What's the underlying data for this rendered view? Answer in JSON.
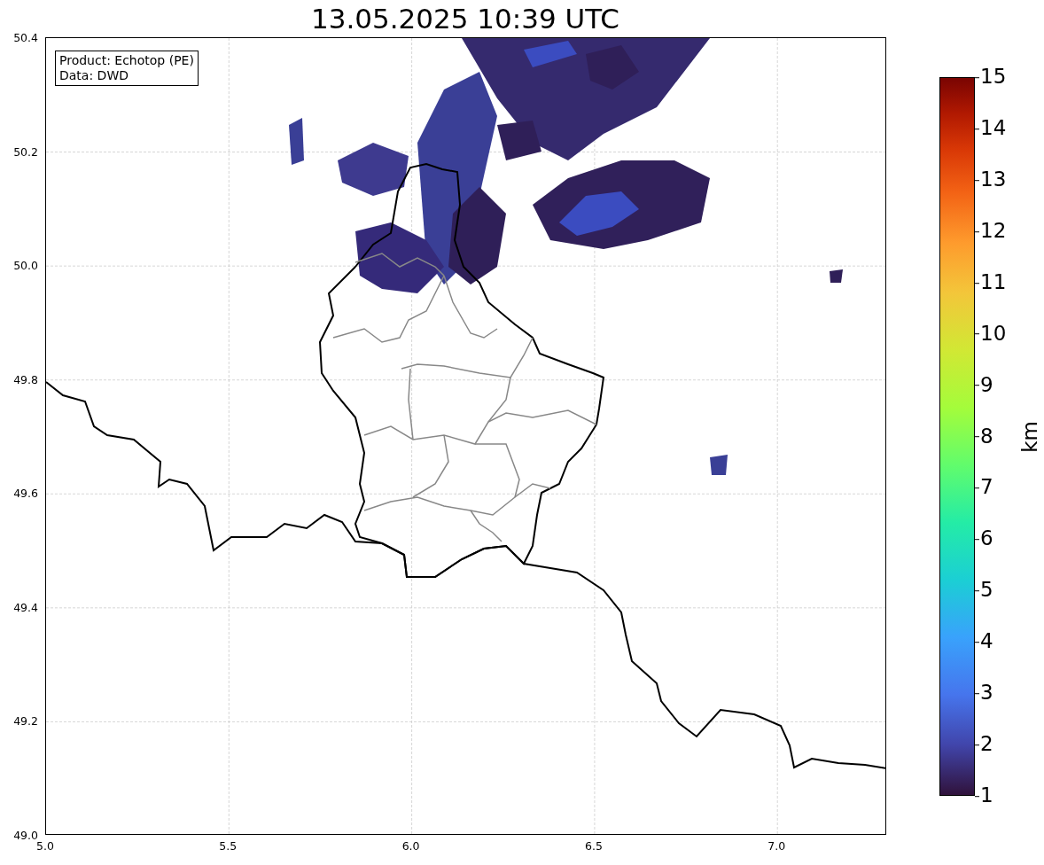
{
  "title": "13.05.2025 10:39 UTC",
  "legend": [
    "Product: Echotop (PE)",
    "Data: DWD"
  ],
  "map": {
    "y_ticks": [
      "50.4",
      "50.2",
      "50.0",
      "49.8",
      "49.6",
      "49.4",
      "49.2",
      "49.0"
    ],
    "x_ticks": [
      "5.0",
      "5.5",
      "6.0",
      "6.5",
      "7.0"
    ]
  },
  "colorbar": {
    "label": "km",
    "ticks": [
      "15",
      "14",
      "13",
      "12",
      "11",
      "10",
      "9",
      "8",
      "7",
      "6",
      "5",
      "4",
      "3",
      "2",
      "1"
    ]
  }
}
